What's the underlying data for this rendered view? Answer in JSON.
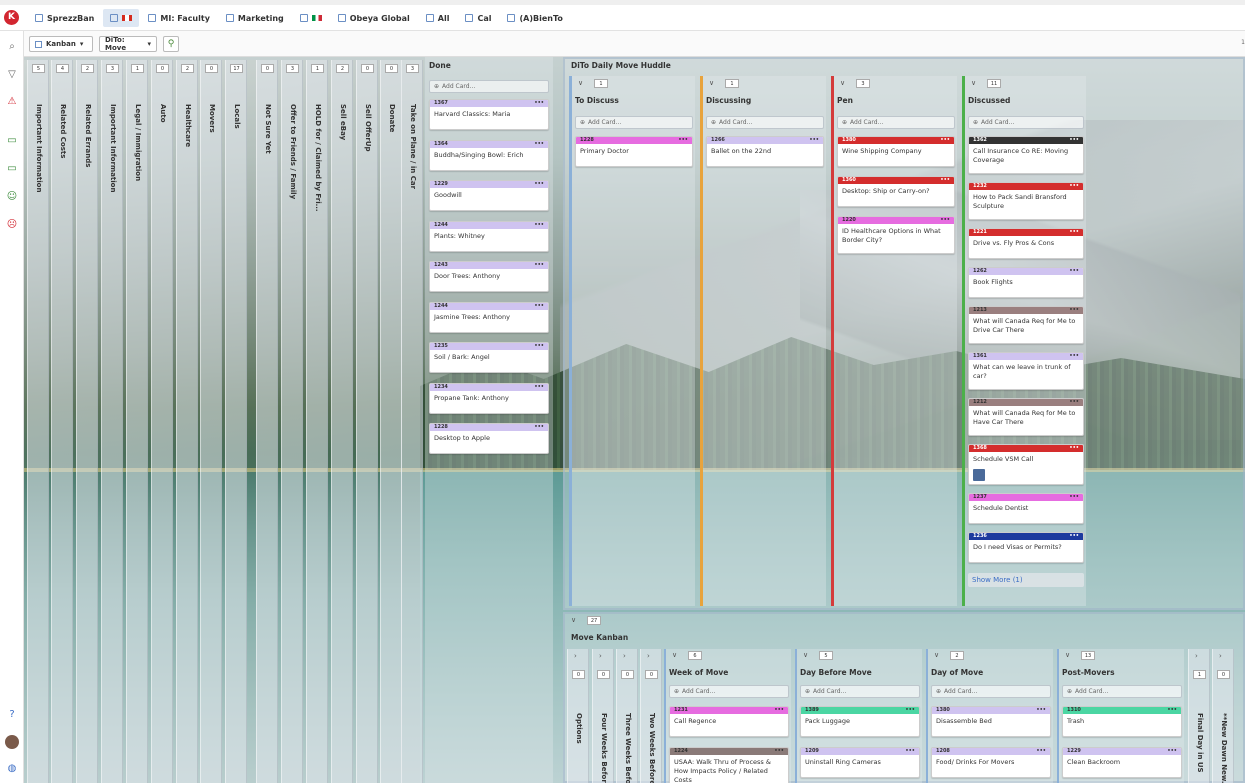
{
  "tabs": [
    {
      "label": "SprezzBan",
      "flag": ""
    },
    {
      "label": "",
      "flag": "ca"
    },
    {
      "label": "MI: Faculty",
      "flag": ""
    },
    {
      "label": "Marketing",
      "flag": ""
    },
    {
      "label": "",
      "flag": "it"
    },
    {
      "label": "Obeya Global",
      "flag": ""
    },
    {
      "label": "All",
      "flag": ""
    },
    {
      "label": "Cal",
      "flag": ""
    },
    {
      "label": "(A)BienTo",
      "flag": ""
    }
  ],
  "toolbar": {
    "view": "Kanban",
    "board": "DiTo: Move",
    "page": "1"
  },
  "logo": "K",
  "lanes": [
    {
      "count": "5",
      "title": "Important Information"
    },
    {
      "count": "4",
      "title": "Related Costs"
    },
    {
      "count": "2",
      "title": "Related Errands"
    },
    {
      "count": "3",
      "title": "Important Information"
    },
    {
      "count": "1",
      "title": "Legal / Immigration"
    },
    {
      "count": "0",
      "title": "Auto"
    },
    {
      "count": "2",
      "title": "Healthcare"
    },
    {
      "count": "0",
      "title": "Movers"
    },
    {
      "count": "17",
      "title": "Locals"
    },
    {
      "count": "0",
      "title": "Not Sure Yet"
    },
    {
      "count": "3",
      "title": "Offer to Friends / Family"
    },
    {
      "count": "1",
      "title": "HOLD for / Claimed by Fri..."
    },
    {
      "count": "2",
      "title": "Sell eBay"
    },
    {
      "count": "0",
      "title": "Sell OfferUp"
    },
    {
      "count": "0",
      "title": "Donate"
    },
    {
      "count": "3",
      "title": "Take on Plane / in Car"
    }
  ],
  "done": {
    "title": "Done",
    "add": "Add Card...",
    "cards": [
      {
        "id": "1367",
        "text": "Harvard Classics: Maria"
      },
      {
        "id": "1364",
        "text": "Buddha/Singing Bowl: Erich"
      },
      {
        "id": "1229",
        "text": "Goodwill"
      },
      {
        "id": "1244",
        "text": "Plants: Whitney"
      },
      {
        "id": "1243",
        "text": "Door Trees: Anthony"
      },
      {
        "id": "1244",
        "text": "Jasmine Trees: Anthony"
      },
      {
        "id": "1235",
        "text": "Soil / Bark: Angel"
      },
      {
        "id": "1234",
        "text": "Propane Tank: Anthony"
      },
      {
        "id": "1228",
        "text": "Desktop to Apple"
      }
    ]
  },
  "huddle": {
    "title": "DiTo Daily Move Huddle",
    "columns": [
      {
        "name": "To Discuss",
        "count": "1",
        "color": "#8bb0d8",
        "add": "Add Card...",
        "cards": [
          {
            "id": "1228",
            "text": "Primary Doctor",
            "c": "magenta"
          }
        ]
      },
      {
        "name": "Discussing",
        "count": "1",
        "color": "#e8a33c",
        "add": "Add Card...",
        "cards": [
          {
            "id": "1266",
            "text": "Ballet on the 22nd",
            "c": "purple"
          }
        ]
      },
      {
        "name": "Pen",
        "count": "3",
        "color": "#d43b3b",
        "add": "Add Card...",
        "cards": [
          {
            "id": "1380",
            "text": "Wine Shipping Company",
            "c": "red"
          },
          {
            "id": "1360",
            "text": "Desktop: Ship or Carry-on?",
            "c": "red"
          },
          {
            "id": "1220",
            "text": "ID Healthcare Options in What Border City?",
            "c": "magenta"
          }
        ]
      },
      {
        "name": "Discussed",
        "count": "11",
        "color": "#4cb04a",
        "add": "Add Card...",
        "cards": [
          {
            "id": "1362",
            "text": "Call Insurance Co RE: Moving Coverage",
            "c": "dark"
          },
          {
            "id": "1232",
            "text": "How to Pack Sandi Bransford Sculpture",
            "c": "red"
          },
          {
            "id": "1221",
            "text": "Drive vs. Fly Pros & Cons",
            "c": "red"
          },
          {
            "id": "1262",
            "text": "Book Flights",
            "c": "purple"
          },
          {
            "id": "1213",
            "text": "What will Canada Req for Me to Drive Car There",
            "c": "mauve"
          },
          {
            "id": "1361",
            "text": "What can we leave in trunk of car?",
            "c": "purple"
          },
          {
            "id": "1212",
            "text": "What will Canada Req for Me to Have Car There",
            "c": "mauve"
          },
          {
            "id": "1368",
            "text": "Schedule VSM Call",
            "c": "red",
            "avatar": true
          },
          {
            "id": "1237",
            "text": "Schedule Dentist",
            "c": "magenta"
          },
          {
            "id": "1236",
            "text": "Do I need Visas or Permits?",
            "c": "navy"
          }
        ],
        "more": "Show More (1)"
      }
    ]
  },
  "move": {
    "title": "Move Kanban",
    "count": "27",
    "lanes": [
      {
        "count": "0",
        "title": "Options"
      },
      {
        "count": "0",
        "title": "Four Weeks Before M..."
      },
      {
        "count": "0",
        "title": "Three Weeks Before ..."
      },
      {
        "count": "0",
        "title": "Two Weeks Before M..."
      }
    ],
    "columns": [
      {
        "name": "Week of Move",
        "count": "6",
        "add": "Add Card...",
        "cards": [
          {
            "id": "1231",
            "text": "Call Regence",
            "c": "magenta"
          },
          {
            "id": "1224",
            "text": "USAA: Walk Thru of Process & How Impacts Policy / Related Costs",
            "c": "tan"
          }
        ]
      },
      {
        "name": "Day Before Move",
        "count": "5",
        "add": "Add Card...",
        "cards": [
          {
            "id": "1389",
            "text": "Pack Luggage",
            "c": "green"
          },
          {
            "id": "1209",
            "text": "Uninstall Ring Cameras",
            "c": "purple"
          }
        ]
      },
      {
        "name": "Day of Move",
        "count": "2",
        "add": "Add Card...",
        "cards": [
          {
            "id": "1380",
            "text": "Disassemble Bed",
            "c": "purple"
          },
          {
            "id": "1208",
            "text": "Food/ Drinks For Movers",
            "c": "purple"
          }
        ]
      },
      {
        "name": "Post-Movers",
        "count": "13",
        "add": "Add Card...",
        "cards": [
          {
            "id": "1310",
            "text": "Trash",
            "c": "green"
          },
          {
            "id": "1229",
            "text": "Clean Backroom",
            "c": "purple"
          }
        ]
      }
    ],
    "right_lanes": [
      {
        "count": "1",
        "title": "Final Day in US"
      },
      {
        "count": "0",
        "title": "**New Dawn New..."
      }
    ]
  }
}
